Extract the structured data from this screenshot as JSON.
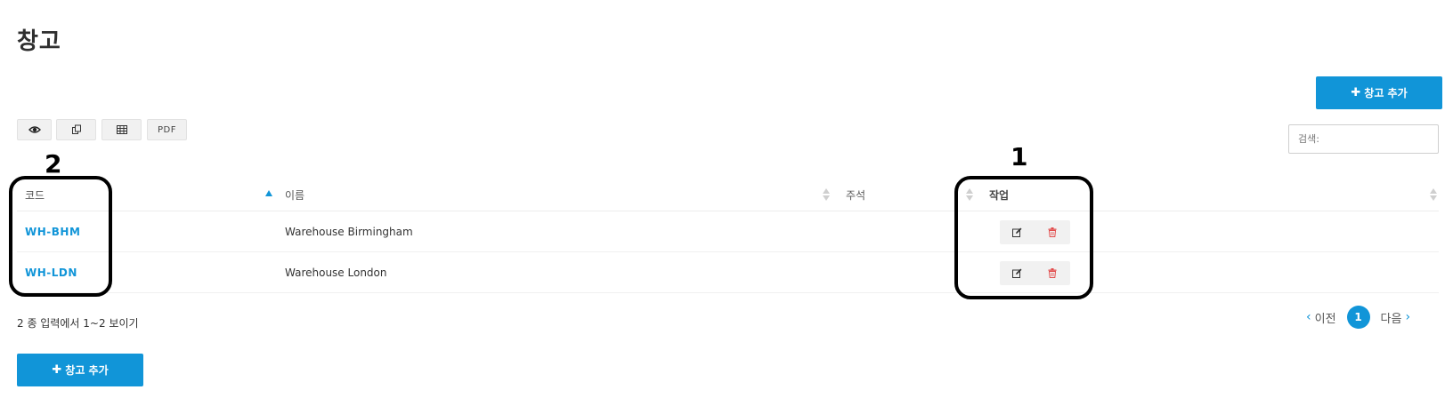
{
  "page": {
    "title": "창고"
  },
  "toolbar": {
    "add_label": "창고 추가",
    "eye_icon": "eye-icon",
    "copy_icon": "copy-icon",
    "csv_icon": "table-icon",
    "pdf_label": "PDF"
  },
  "search": {
    "placeholder": "검색:"
  },
  "table": {
    "columns": [
      "코드",
      "이름",
      "주석",
      "작업"
    ],
    "rows": [
      {
        "code": "WH-BHM",
        "name": "Warehouse Birmingham",
        "note": ""
      },
      {
        "code": "WH-LDN",
        "name": "Warehouse London",
        "note": ""
      }
    ]
  },
  "footer": {
    "info": "2 종 입력에서 1~2 보이기",
    "prev_label": "이전",
    "current_page": "1",
    "next_label": "다음",
    "add_label": "창고 추가"
  },
  "annotations": [
    {
      "number": "1",
      "target": "actions-column"
    },
    {
      "number": "2",
      "target": "code-column"
    }
  ],
  "colors": {
    "accent": "#1195d8",
    "delete": "#e24b4b",
    "annotation": "#000000"
  }
}
